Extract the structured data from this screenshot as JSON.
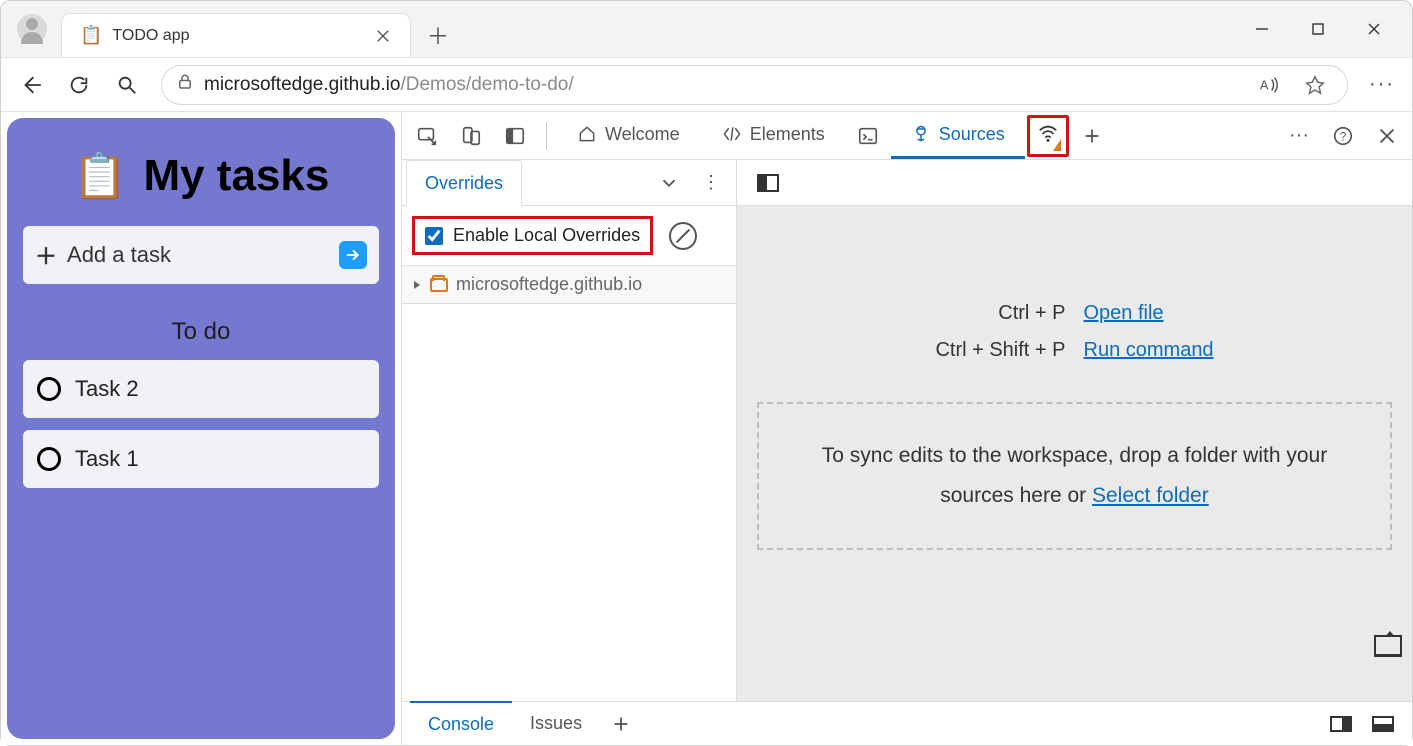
{
  "browser": {
    "tab": {
      "favicon": "📋",
      "title": "TODO app"
    },
    "url": {
      "host": "microsoftedge.github.io",
      "path": "/Demos/demo-to-do/"
    }
  },
  "app": {
    "title": "My tasks",
    "add_placeholder": "Add a task",
    "section": "To do",
    "tasks": [
      "Task 2",
      "Task 1"
    ]
  },
  "devtools": {
    "tabs": {
      "welcome": "Welcome",
      "elements": "Elements",
      "sources": "Sources"
    },
    "overrides_tab": "Overrides",
    "enable_overrides": "Enable Local Overrides",
    "enable_overrides_checked": true,
    "tree_domain": "microsoftedge.github.io",
    "shortcuts": {
      "open_keys": "Ctrl + P",
      "open_label": "Open file",
      "run_keys": "Ctrl + Shift + P",
      "run_label": "Run command"
    },
    "dropzone_prefix": "To sync edits to the workspace, drop a folder with your sources here or ",
    "dropzone_link": "Select folder",
    "bottom": {
      "console": "Console",
      "issues": "Issues"
    }
  }
}
